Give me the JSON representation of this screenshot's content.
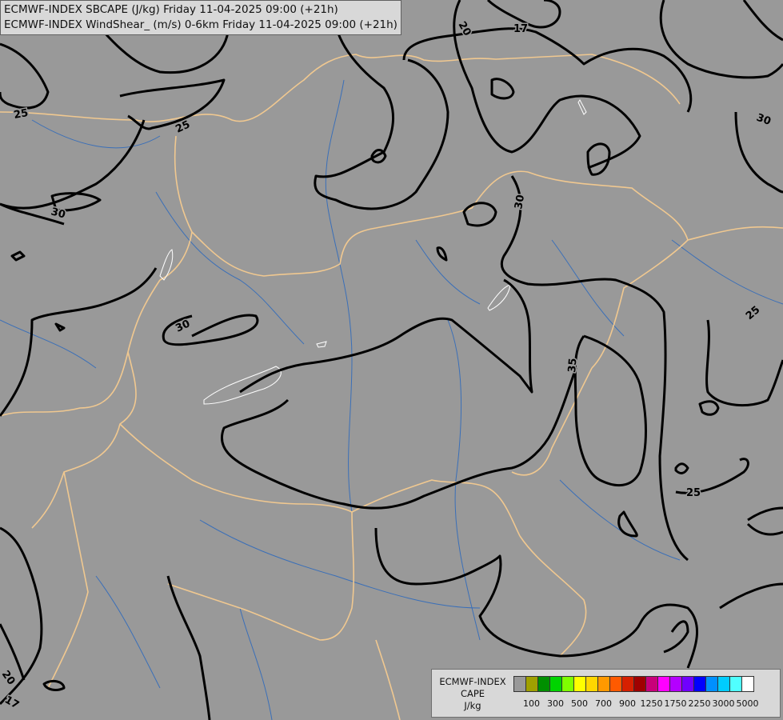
{
  "header": {
    "line1": "ECMWF-INDEX SBCAPE (J/kg) Friday 11-04-2025 09:00 (+21h)",
    "line2": "ECMWF-INDEX WindShear_ (m/s) 0-6km Friday 11-04-2025 09:00 (+21h)"
  },
  "contour_labels": [
    "25",
    "25",
    "30",
    "30",
    "20",
    "17",
    "30",
    "30",
    "35",
    "25",
    "25",
    "20",
    "17"
  ],
  "legend": {
    "title_line1": "ECMWF-INDEX",
    "title_line2": "CAPE",
    "title_line3": "J/kg",
    "colors": [
      "#999999",
      "#a0a000",
      "#008f00",
      "#00d400",
      "#7fff00",
      "#ffff00",
      "#ffd700",
      "#ff9900",
      "#ff5a00",
      "#d62000",
      "#a00000",
      "#c8007a",
      "#ff00ff",
      "#b400ff",
      "#7000ff",
      "#0000ff",
      "#0090ff",
      "#00ccff",
      "#50ffff",
      "#ffffff"
    ],
    "ticks": [
      "100",
      "300",
      "500",
      "700",
      "900",
      "1250",
      "1750",
      "2250",
      "3000",
      "5000"
    ]
  },
  "colors": {
    "background": "#999999",
    "borders": "#f0c890",
    "rivers": "#3a6fb8",
    "contours": "#000000"
  }
}
